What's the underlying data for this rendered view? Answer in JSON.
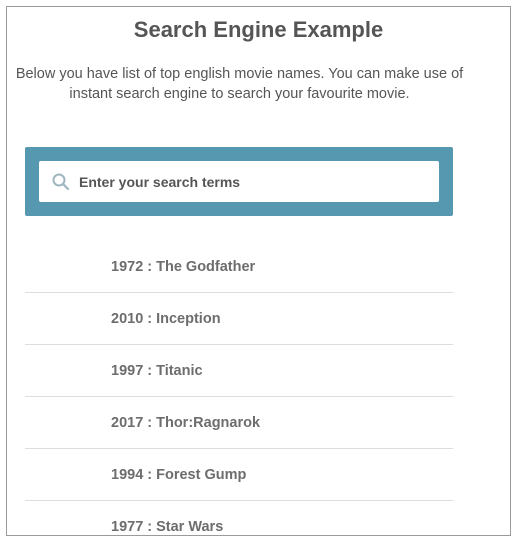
{
  "header": {
    "title": "Search Engine Example",
    "description": "Below you have list of top english movie names. You can make use of instant search engine to search your favourite movie."
  },
  "search": {
    "placeholder": "Enter your search terms",
    "value": "",
    "icon": "search-icon"
  },
  "movies": [
    {
      "year": "1972",
      "title": "The Godfather"
    },
    {
      "year": "2010",
      "title": "Inception"
    },
    {
      "year": "1997",
      "title": "Titanic"
    },
    {
      "year": "2017",
      "title": "Thor:Ragnarok"
    },
    {
      "year": "1994",
      "title": "Forest Gump"
    },
    {
      "year": "1977",
      "title": "Star Wars"
    }
  ],
  "movie_separator": ":",
  "colors": {
    "search_panel": "#5698b0",
    "text": "#555555",
    "list_text": "#6d6d6d",
    "divider": "#dddddd"
  }
}
